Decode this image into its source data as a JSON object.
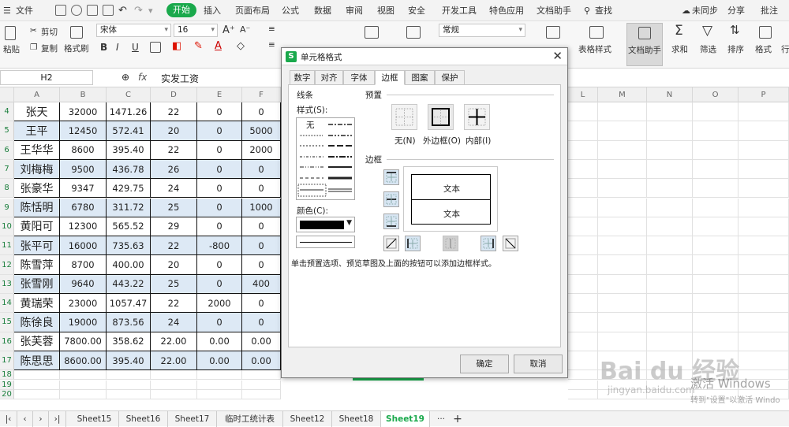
{
  "menu": {
    "file": "文件",
    "items": [
      "开始",
      "插入",
      "页面布局",
      "公式",
      "数据",
      "审阅",
      "视图",
      "安全",
      "开发工具",
      "特色应用",
      "文档助手"
    ],
    "search": "查找",
    "sync": "未同步",
    "share": "分享",
    "comment": "批注"
  },
  "ribbon": {
    "paste": "粘贴",
    "cut": "剪切",
    "copy": "复制",
    "format_painter": "格式刷",
    "font": "宋体",
    "size": "16",
    "number_format": "常规",
    "table_style": "表格样式",
    "doc_helper": "文档助手",
    "sum": "求和",
    "filter": "筛选",
    "sort": "排序",
    "format": "格式",
    "rowcol": "行和列",
    "bold": "B",
    "italic": "I",
    "underline": "U"
  },
  "formula_bar": {
    "cell_ref": "H2",
    "fx": "fx",
    "content": "实发工资"
  },
  "columns": [
    "A",
    "B",
    "C",
    "D",
    "E",
    "F",
    "L",
    "M",
    "N",
    "O",
    "P"
  ],
  "rows": [
    {
      "num": "4",
      "cells": [
        "张天",
        "32000",
        "1471.26",
        "22",
        "0",
        "0"
      ]
    },
    {
      "num": "5",
      "cells": [
        "王平",
        "12450",
        "572.41",
        "20",
        "0",
        "5000"
      ]
    },
    {
      "num": "6",
      "cells": [
        "王华华",
        "8600",
        "395.40",
        "22",
        "0",
        "2000"
      ]
    },
    {
      "num": "7",
      "cells": [
        "刘梅梅",
        "9500",
        "436.78",
        "26",
        "0",
        "0"
      ]
    },
    {
      "num": "8",
      "cells": [
        "张豪华",
        "9347",
        "429.75",
        "24",
        "0",
        "0"
      ]
    },
    {
      "num": "9",
      "cells": [
        "陈恬明",
        "6780",
        "311.72",
        "25",
        "0",
        "1000"
      ]
    },
    {
      "num": "10",
      "cells": [
        "黄阳可",
        "12300",
        "565.52",
        "29",
        "0",
        "0"
      ]
    },
    {
      "num": "11",
      "cells": [
        "张平可",
        "16000",
        "735.63",
        "22",
        "-800",
        "0"
      ]
    },
    {
      "num": "12",
      "cells": [
        "陈雪萍",
        "8700",
        "400.00",
        "20",
        "0",
        "0"
      ]
    },
    {
      "num": "13",
      "cells": [
        "张雪刚",
        "9640",
        "443.22",
        "25",
        "0",
        "400"
      ]
    },
    {
      "num": "14",
      "cells": [
        "黄瑞荣",
        "23000",
        "1057.47",
        "22",
        "2000",
        "0"
      ]
    },
    {
      "num": "15",
      "cells": [
        "陈徐良",
        "19000",
        "873.56",
        "24",
        "0",
        "0"
      ]
    },
    {
      "num": "16",
      "cells": [
        "张芙蓉",
        "7800.00",
        "358.62",
        "22.00",
        "0.00",
        "0.00"
      ]
    },
    {
      "num": "17",
      "cells": [
        "陈思思",
        "8600.00",
        "395.40",
        "22.00",
        "0.00",
        "0.00"
      ]
    },
    {
      "num": "18",
      "cells": []
    },
    {
      "num": "19",
      "cells": []
    },
    {
      "num": "20",
      "cells": []
    }
  ],
  "sheet_tabs": [
    "Sheet15",
    "Sheet16",
    "Sheet17",
    "临时工统计表",
    "Sheet12",
    "Sheet18",
    "Sheet19"
  ],
  "active_sheet": "Sheet19",
  "dialog": {
    "title": "单元格格式",
    "tabs": [
      "数字",
      "对齐",
      "字体",
      "边框",
      "图案",
      "保护"
    ],
    "active_tab": "边框",
    "line_group": "线条",
    "style_label": "样式(S):",
    "none_style": "无",
    "color_label": "颜色(C):",
    "preset_group": "预置",
    "presets": [
      "无(N)",
      "外边框(O)",
      "内部(I)"
    ],
    "border_group": "边框",
    "preview_text": "文本",
    "hint": "单击预置选项、预览草图及上面的按钮可以添加边框样式。",
    "ok": "确定",
    "cancel": "取消"
  },
  "watermark": {
    "brand": "Bai du 经验",
    "url": "jingyan.baidu.com",
    "activate": "激活 Windows",
    "activate_hint": "转到\"设置\"以激活 Windo"
  }
}
